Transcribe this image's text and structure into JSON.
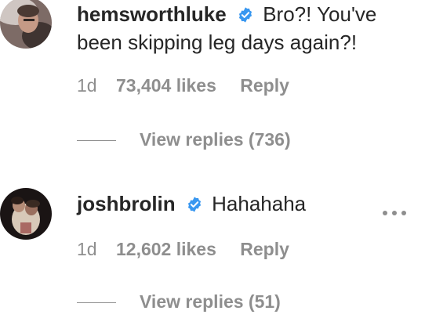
{
  "comments": [
    {
      "username": "hemsworthluke",
      "verified": true,
      "text": "Bro?! You've been skipping leg days again?!",
      "time": "1d",
      "likes": "73,404 likes",
      "reply_label": "Reply",
      "view_replies": "View replies (736)",
      "avatar_icon": "avatar-photo"
    },
    {
      "username": "joshbrolin",
      "verified": true,
      "text": "Hahahaha",
      "time": "1d",
      "likes": "12,602 likes",
      "reply_label": "Reply",
      "view_replies": "View replies (51)",
      "avatar_icon": "avatar-photo",
      "more_icon": "ellipsis-icon"
    }
  ],
  "colors": {
    "text": "#262626",
    "muted": "#8e8e8e",
    "verified": "#3897f0"
  }
}
